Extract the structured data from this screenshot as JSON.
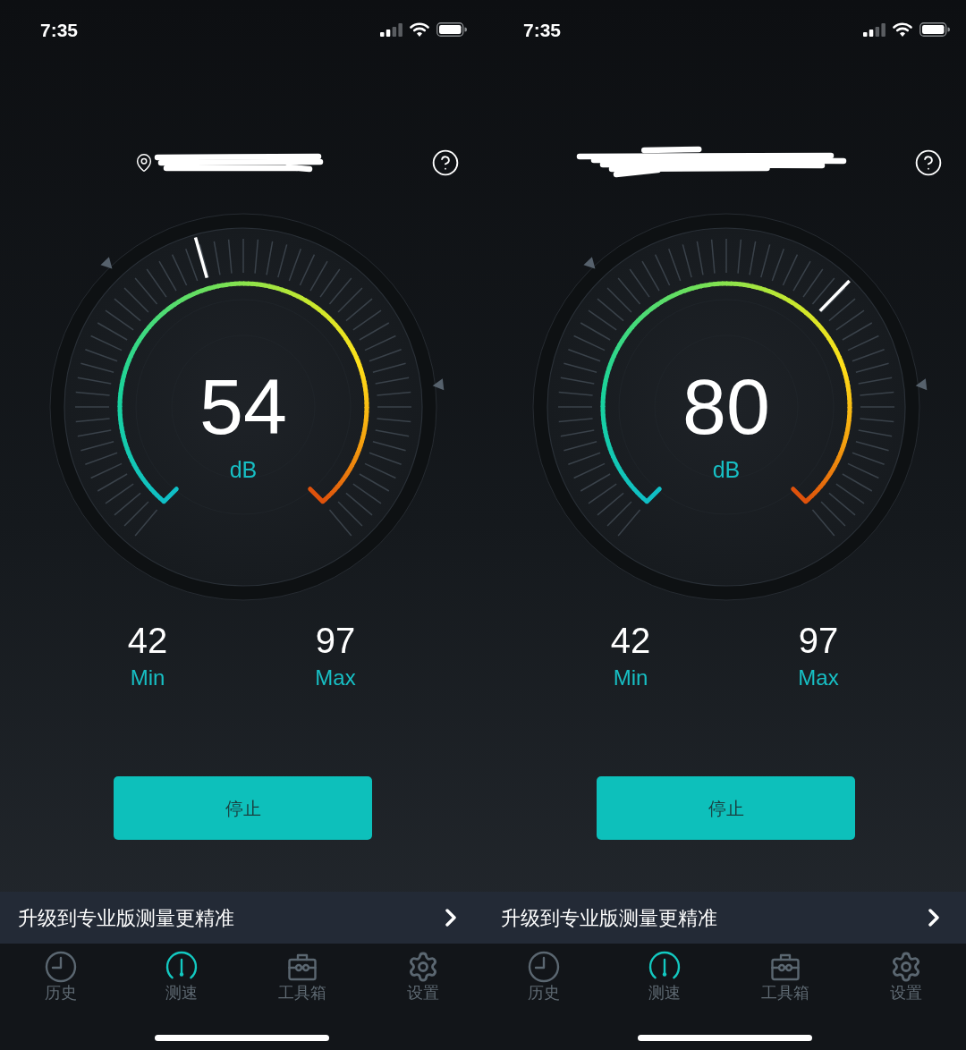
{
  "screens": [
    {
      "status_bar": {
        "time": "7:35"
      },
      "location": {
        "pin": true
      },
      "gauge": {
        "reading": "54",
        "unit": "dB"
      },
      "stats": [
        {
          "value": "42",
          "label": "Min"
        },
        {
          "value": "97",
          "label": "Max"
        }
      ],
      "stop_button": "停止",
      "promo_banner": "升级到专业版测量更精准",
      "tabs": [
        {
          "label": "历史",
          "selected": false
        },
        {
          "label": "测速",
          "selected": true
        },
        {
          "label": "工具箱",
          "selected": false
        },
        {
          "label": "设置",
          "selected": false
        }
      ]
    },
    {
      "status_bar": {
        "time": "7:35"
      },
      "location": {
        "pin": false
      },
      "gauge": {
        "reading": "80",
        "unit": "dB"
      },
      "stats": [
        {
          "value": "42",
          "label": "Min"
        },
        {
          "value": "97",
          "label": "Max"
        }
      ],
      "stop_button": "停止",
      "promo_banner": "升级到专业版测量更精准",
      "tabs": [
        {
          "label": "历史",
          "selected": false
        },
        {
          "label": "测速",
          "selected": true
        },
        {
          "label": "工具箱",
          "selected": false
        },
        {
          "label": "设置",
          "selected": false
        }
      ]
    }
  ]
}
